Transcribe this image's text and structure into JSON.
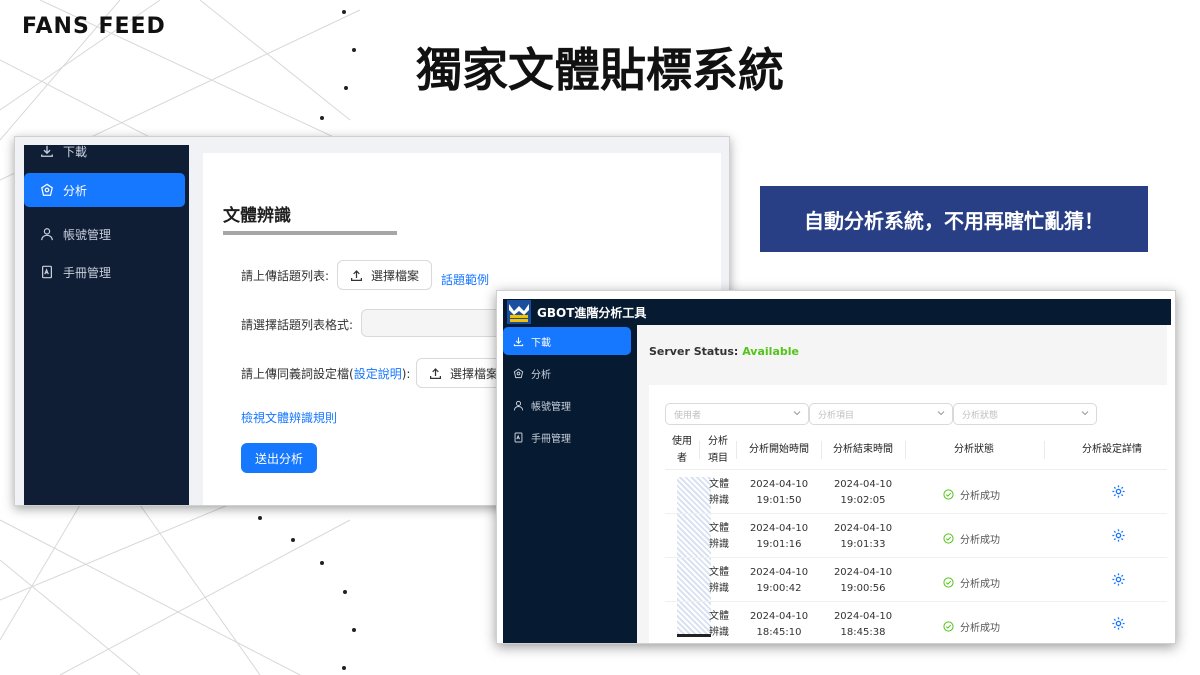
{
  "slide": {
    "brand": "FANS FEED",
    "title": "獨家文體貼標系統",
    "slogan": "自動分析系統，不用再瞎忙亂猜！"
  },
  "shot1": {
    "sidebar": [
      {
        "label": "下載",
        "icon": "download-icon",
        "active": false
      },
      {
        "label": "分析",
        "icon": "analysis-icon",
        "active": true
      },
      {
        "label": "帳號管理",
        "icon": "user-icon",
        "active": false
      },
      {
        "label": "手冊管理",
        "icon": "pdf-icon",
        "active": false
      }
    ],
    "card_title": "文體辨識",
    "form": {
      "upload_topics_label": "請上傳話題列表:",
      "choose_file": "選擇檔案",
      "topic_example_link": "話題範例",
      "format_label": "請選擇話題列表格式:",
      "synonym_label_prefix": "請上傳同義詞設定檔(",
      "synonym_link": "設定說明",
      "synonym_label_suffix": "):",
      "rules_link": "檢視文體辨識規則",
      "submit": "送出分析"
    }
  },
  "shot2": {
    "app_title": "GBOT進階分析工具",
    "sidebar": [
      {
        "label": "下載",
        "icon": "download-icon",
        "active": true
      },
      {
        "label": "分析",
        "icon": "analysis-icon",
        "active": false
      },
      {
        "label": "帳號管理",
        "icon": "user-icon",
        "active": false
      },
      {
        "label": "手冊管理",
        "icon": "pdf-icon",
        "active": false
      }
    ],
    "server_status_label": "Server Status:",
    "server_status_value": "Available",
    "filters": [
      "使用者",
      "分析項目",
      "分析狀態"
    ],
    "columns": [
      "使用者",
      "分析項目",
      "分析開始時間",
      "分析結束時間",
      "分析狀態",
      "分析設定詳情"
    ],
    "rows": [
      {
        "item": "文體辨識",
        "start_date": "2024-04-10",
        "start_time": "19:01:50",
        "end_date": "2024-04-10",
        "end_time": "19:02:05",
        "status": "分析成功"
      },
      {
        "item": "文體辨識",
        "start_date": "2024-04-10",
        "start_time": "19:01:16",
        "end_date": "2024-04-10",
        "end_time": "19:01:33",
        "status": "分析成功"
      },
      {
        "item": "文體辨識",
        "start_date": "2024-04-10",
        "start_time": "19:00:42",
        "end_date": "2024-04-10",
        "end_time": "19:00:56",
        "status": "分析成功"
      },
      {
        "item": "文體辨識",
        "start_date": "2024-04-10",
        "start_time": "18:45:10",
        "end_date": "2024-04-10",
        "end_time": "18:45:38",
        "status": "分析成功"
      }
    ]
  }
}
